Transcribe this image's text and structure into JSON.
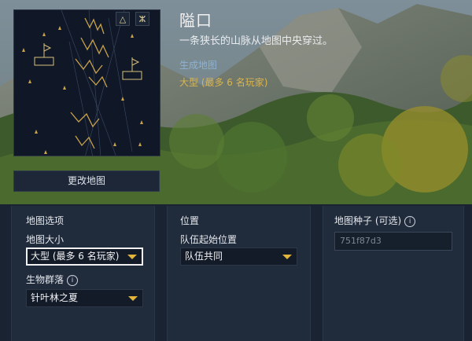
{
  "map": {
    "title": "隘口",
    "description": "一条狭长的山脉从地图中央穿过。",
    "generate_link": "生成地图",
    "size_text": "大型 (最多 6 名玩家)",
    "change_button": "更改地图",
    "icon_a": "△",
    "icon_b": "ⵣ"
  },
  "map_options": {
    "heading": "地图选项",
    "size_label": "地图大小",
    "size_value": "大型 (最多 6 名玩家)",
    "biome_label": "生物群落",
    "biome_value": "针叶林之夏",
    "info_icon": "i"
  },
  "position": {
    "heading": "位置",
    "team_label": "队伍起始位置",
    "team_value": "队伍共同"
  },
  "seed": {
    "label": "地图种子 (可选)",
    "placeholder": "751f87d3",
    "info_icon": "i"
  },
  "colors": {
    "accent_gold": "#d9b552",
    "link_blue": "#8fb2d2",
    "panel": "#202b3b"
  }
}
